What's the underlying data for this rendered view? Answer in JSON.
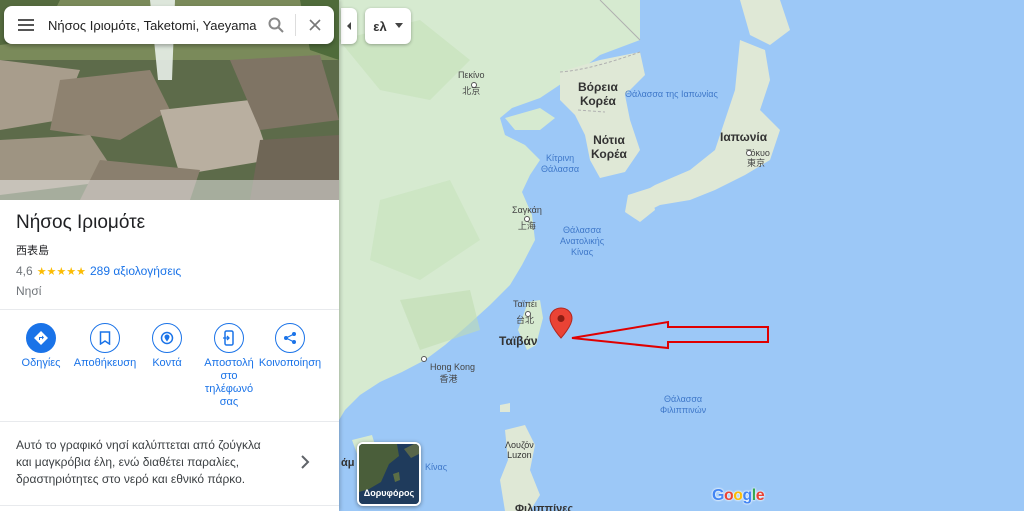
{
  "search": {
    "value": "Νήσος Ιριομότε, Taketomi, Yaeyama"
  },
  "place": {
    "title": "Νήσος Ιριομότε",
    "native_name": "西表島",
    "rating": "4,6",
    "stars": "★★★★★",
    "reviews": "289 αξιολογήσεις",
    "type": "Νησί",
    "description_lines": [
      "Αυτό το γραφικό νησί καλύπτεται από ζούγκλα",
      "και μαγκρόβια έλη, ενώ διαθέτει παραλίες,",
      "δραστηριότητες στο νερό και εθνικό πάρκο."
    ]
  },
  "actions": [
    {
      "label_lines": [
        "Οδηγίες"
      ],
      "icon": "directions-icon"
    },
    {
      "label_lines": [
        "Αποθήκευση"
      ],
      "icon": "bookmark-icon"
    },
    {
      "label_lines": [
        "Κοντά"
      ],
      "icon": "nearby-icon"
    },
    {
      "label_lines": [
        "Αποστολή",
        "στο",
        "τηλέφωνό",
        "σας"
      ],
      "icon": "send-to-phone-icon"
    },
    {
      "label_lines": [
        "Κοινοποίηση"
      ],
      "icon": "share-icon"
    }
  ],
  "map": {
    "language_button": "ελ",
    "satellite_label": "Δορυφόρος",
    "logo": "Google",
    "countries": {
      "north_korea": [
        "Βόρεια",
        "Κορέα"
      ],
      "south_korea": [
        "Νότια",
        "Κορέα"
      ],
      "japan": "Ιαπωνία",
      "taiwan": "Ταϊβάν"
    },
    "seas": {
      "sea_of_japan": "Θάλασσα της Ιαπωνίας",
      "yellow_sea": [
        "Κίτρινη",
        "Θάλασσα"
      ],
      "east_china_sea": [
        "Θάλασσα",
        "Ανατολικής",
        "Κίνας"
      ],
      "philippine_sea": [
        "Θάλασσα",
        "Φιλιππινών"
      ],
      "south_china_sea_partial": "Κίνας"
    },
    "cities": {
      "beijing": [
        "Πεκίνο",
        "北京"
      ],
      "tokyo": [
        "Τόκυο",
        "東京"
      ],
      "shanghai": [
        "Σαγκάη",
        "上海"
      ],
      "taipei": [
        "Ταϊπέι",
        "台北"
      ],
      "hong_kong": [
        "Hong Kong",
        "香港"
      ],
      "luzon": [
        "Λουζόν",
        "Luzon"
      ]
    },
    "partial_labels": {
      "left_edge": "άμ",
      "philippines_bottom": "Φιλιππίνες"
    },
    "colors": {
      "water": "#aadaff",
      "land": "#cfe6c4",
      "accent": "#1a73e8",
      "pin": "#ea4335",
      "arrow": "#e00000"
    }
  }
}
